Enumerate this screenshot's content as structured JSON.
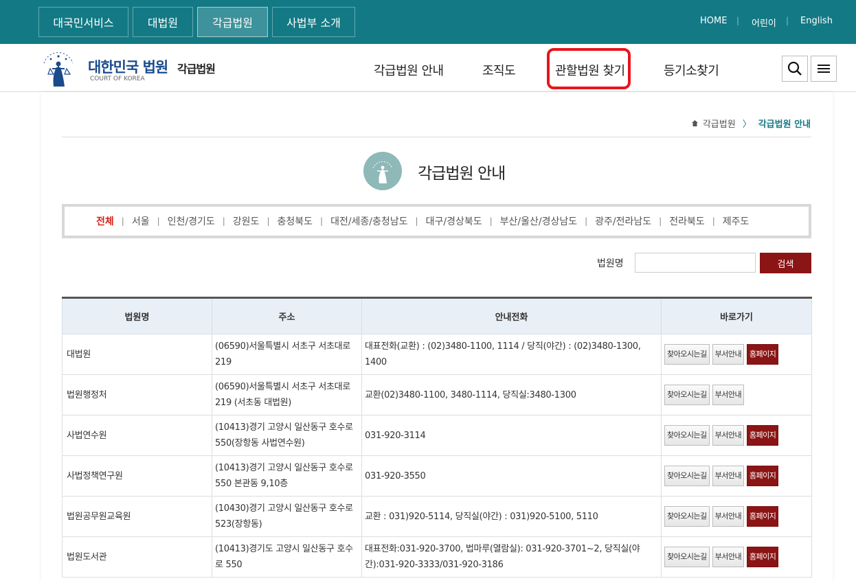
{
  "topbar": {
    "tabs": [
      {
        "label": "대국민서비스"
      },
      {
        "label": "대법원"
      },
      {
        "label": "각급법원"
      },
      {
        "label": "사법부 소개"
      }
    ],
    "util": {
      "home": "HOME",
      "kids": "어린이",
      "english": "English"
    }
  },
  "header": {
    "logo_title": "대한민국 법원",
    "logo_sub": "각급법원",
    "logo_eng": "COURT OF KOREA",
    "nav": [
      {
        "label": "각급법원 안내"
      },
      {
        "label": "조직도"
      },
      {
        "label": "관할법원 찾기"
      },
      {
        "label": "등기소찾기"
      }
    ],
    "highlight_color": "#e8141c"
  },
  "breadcrumb": {
    "home": "각급법원",
    "separator": "〉",
    "current": "각급법원 안내"
  },
  "page": {
    "title": "각급법원 안내"
  },
  "regions": [
    {
      "label": "전체",
      "active": true
    },
    {
      "label": "서울"
    },
    {
      "label": "인천/경기도"
    },
    {
      "label": "강원도"
    },
    {
      "label": "충청북도"
    },
    {
      "label": "대전/세종/충청남도"
    },
    {
      "label": "대구/경상북도"
    },
    {
      "label": "부산/울산/경상남도"
    },
    {
      "label": "광주/전라남도"
    },
    {
      "label": "전라북도"
    },
    {
      "label": "제주도"
    }
  ],
  "search": {
    "label": "법원명",
    "value": "",
    "button": "검색"
  },
  "table": {
    "headers": [
      "법원명",
      "주소",
      "안내전화",
      "바로가기"
    ],
    "link_labels": {
      "directions": "찾아오시는길",
      "dept": "부서안내",
      "home": "홈페이지"
    },
    "rows": [
      {
        "name": "대법원",
        "address": "(06590)서울특별시 서초구 서초대로 219",
        "phone": "대표전화(교환) : (02)3480-1100, 1114 / 당직(야간) : (02)3480-1300, 1400",
        "has_home": true
      },
      {
        "name": "법원행정처",
        "address": "(06590)서울특별시 서초구 서초대로 219 (서초동 대법원)",
        "phone": "교환(02)3480-1100, 3480-1114, 당직실:3480-1300",
        "has_home": false
      },
      {
        "name": "사법연수원",
        "address": "(10413)경기 고양시 일산동구 호수로 550(장항동 사법연수원)",
        "phone": "031-920-3114",
        "has_home": true
      },
      {
        "name": "사법정책연구원",
        "address": "(10413)경기 고양시 일산동구 호수로 550 본관동 9,10층",
        "phone": "031-920-3550",
        "has_home": true
      },
      {
        "name": "법원공무원교육원",
        "address": "(10430)경기 고양시 일산동구 호수로 523(장항동)",
        "phone": "교환 : 031)920-5114, 당직실(야간) : 031)920-5100, 5110",
        "has_home": true
      },
      {
        "name": "법원도서관",
        "address": "(10413)경기도 고양시 일산동구 호수로 550",
        "phone": "대표전화:031-920-3700, 법마루(열람실): 031-920-3701~2, 당직실(야간):031-920-3333/031-920-3186",
        "has_home": true
      }
    ]
  }
}
